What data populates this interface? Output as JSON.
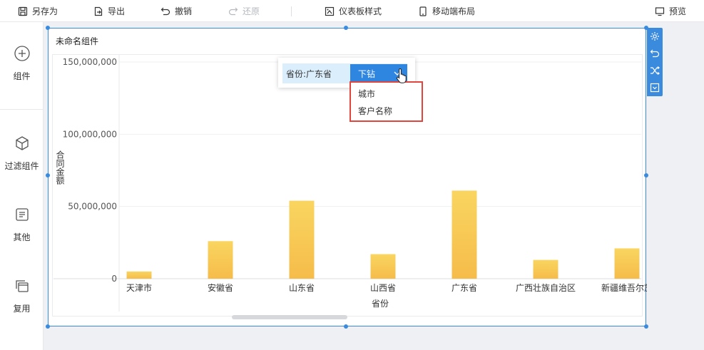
{
  "toolbar": {
    "save_as": "另存为",
    "export": "导出",
    "undo": "撤销",
    "redo": "还原",
    "dashboard_style": "仪表板样式",
    "mobile_layout": "移动端布局",
    "preview": "预览"
  },
  "sidebar": {
    "items": [
      {
        "label": "组件",
        "icon": "plus-circle-icon"
      },
      {
        "label": "过滤组件",
        "icon": "cube-icon"
      },
      {
        "label": "其他",
        "icon": "document-icon"
      },
      {
        "label": "复用",
        "icon": "stack-icon"
      }
    ]
  },
  "widget": {
    "title": "未命名组件",
    "tools": [
      "gear-icon",
      "undo-icon",
      "shuffle-icon",
      "collapse-icon"
    ]
  },
  "drill": {
    "field": "省份:广东省",
    "button": "下钻",
    "options": [
      "城市",
      "客户名称"
    ]
  },
  "colors": {
    "accent": "#2f86e0",
    "bar_top": "#f9d560",
    "bar_bottom": "#f6bc4a",
    "highlight": "#e0463e"
  },
  "chart_data": {
    "type": "bar",
    "xlabel": "省份",
    "ylabel": "合同金额",
    "yticks": [
      "150,000,000",
      "100,000,000",
      "50,000,000",
      "0"
    ],
    "ytick_values": [
      150000000,
      100000000,
      50000000,
      0
    ],
    "ylim": [
      0,
      150000000
    ],
    "categories": [
      "天津市",
      "安徽省",
      "山东省",
      "山西省",
      "广东省",
      "广西壮族自治区",
      "新疆维吾尔族"
    ],
    "values": [
      5000000,
      26000000,
      54000000,
      17000000,
      61000000,
      13000000,
      21000000
    ],
    "grid": true
  }
}
